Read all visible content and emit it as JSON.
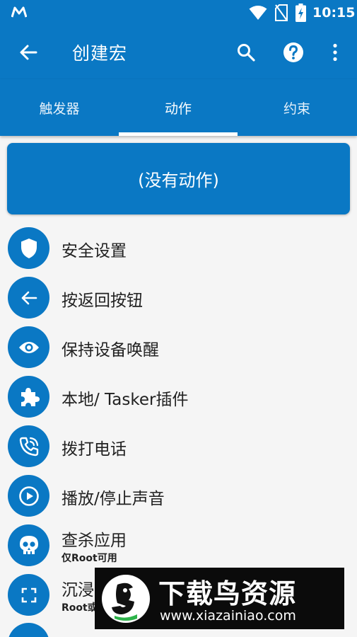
{
  "status_bar": {
    "time": "10:15",
    "icons": [
      "macrodroid-m-icon",
      "wifi-icon",
      "no-sim-icon",
      "battery-charging-icon"
    ]
  },
  "app_bar": {
    "title": "创建宏",
    "actions": [
      "back-arrow-icon",
      "search-icon",
      "help-icon",
      "more-vert-icon"
    ]
  },
  "tabs": [
    {
      "label": "触发器",
      "active": false
    },
    {
      "label": "动作",
      "active": true
    },
    {
      "label": "约束",
      "active": false
    }
  ],
  "no_actions_label": "(没有动作)",
  "action_items": [
    {
      "label": "安全设置",
      "sublabel": "",
      "icon": "shield-icon"
    },
    {
      "label": "按返回按钮",
      "sublabel": "",
      "icon": "back-arrow-icon"
    },
    {
      "label": "保持设备唤醒",
      "sublabel": "",
      "icon": "eye-icon"
    },
    {
      "label": "本地/ Tasker插件",
      "sublabel": "",
      "icon": "puzzle-icon"
    },
    {
      "label": "拨打电话",
      "sublabel": "",
      "icon": "phone-call-icon"
    },
    {
      "label": "播放/停止声音",
      "sublabel": "",
      "icon": "play-circle-icon"
    },
    {
      "label": "查杀应用",
      "sublabel": "仅Root可用",
      "icon": "skull-icon"
    },
    {
      "label": "沉浸",
      "sublabel": "Root或",
      "icon": "fullscreen-icon"
    }
  ],
  "watermark": {
    "title": "下载鸟资源",
    "url": "www.xiazainiao.com"
  },
  "colors": {
    "primary": "#0a78c4",
    "background": "#f5f5f5",
    "text": "#212121"
  }
}
